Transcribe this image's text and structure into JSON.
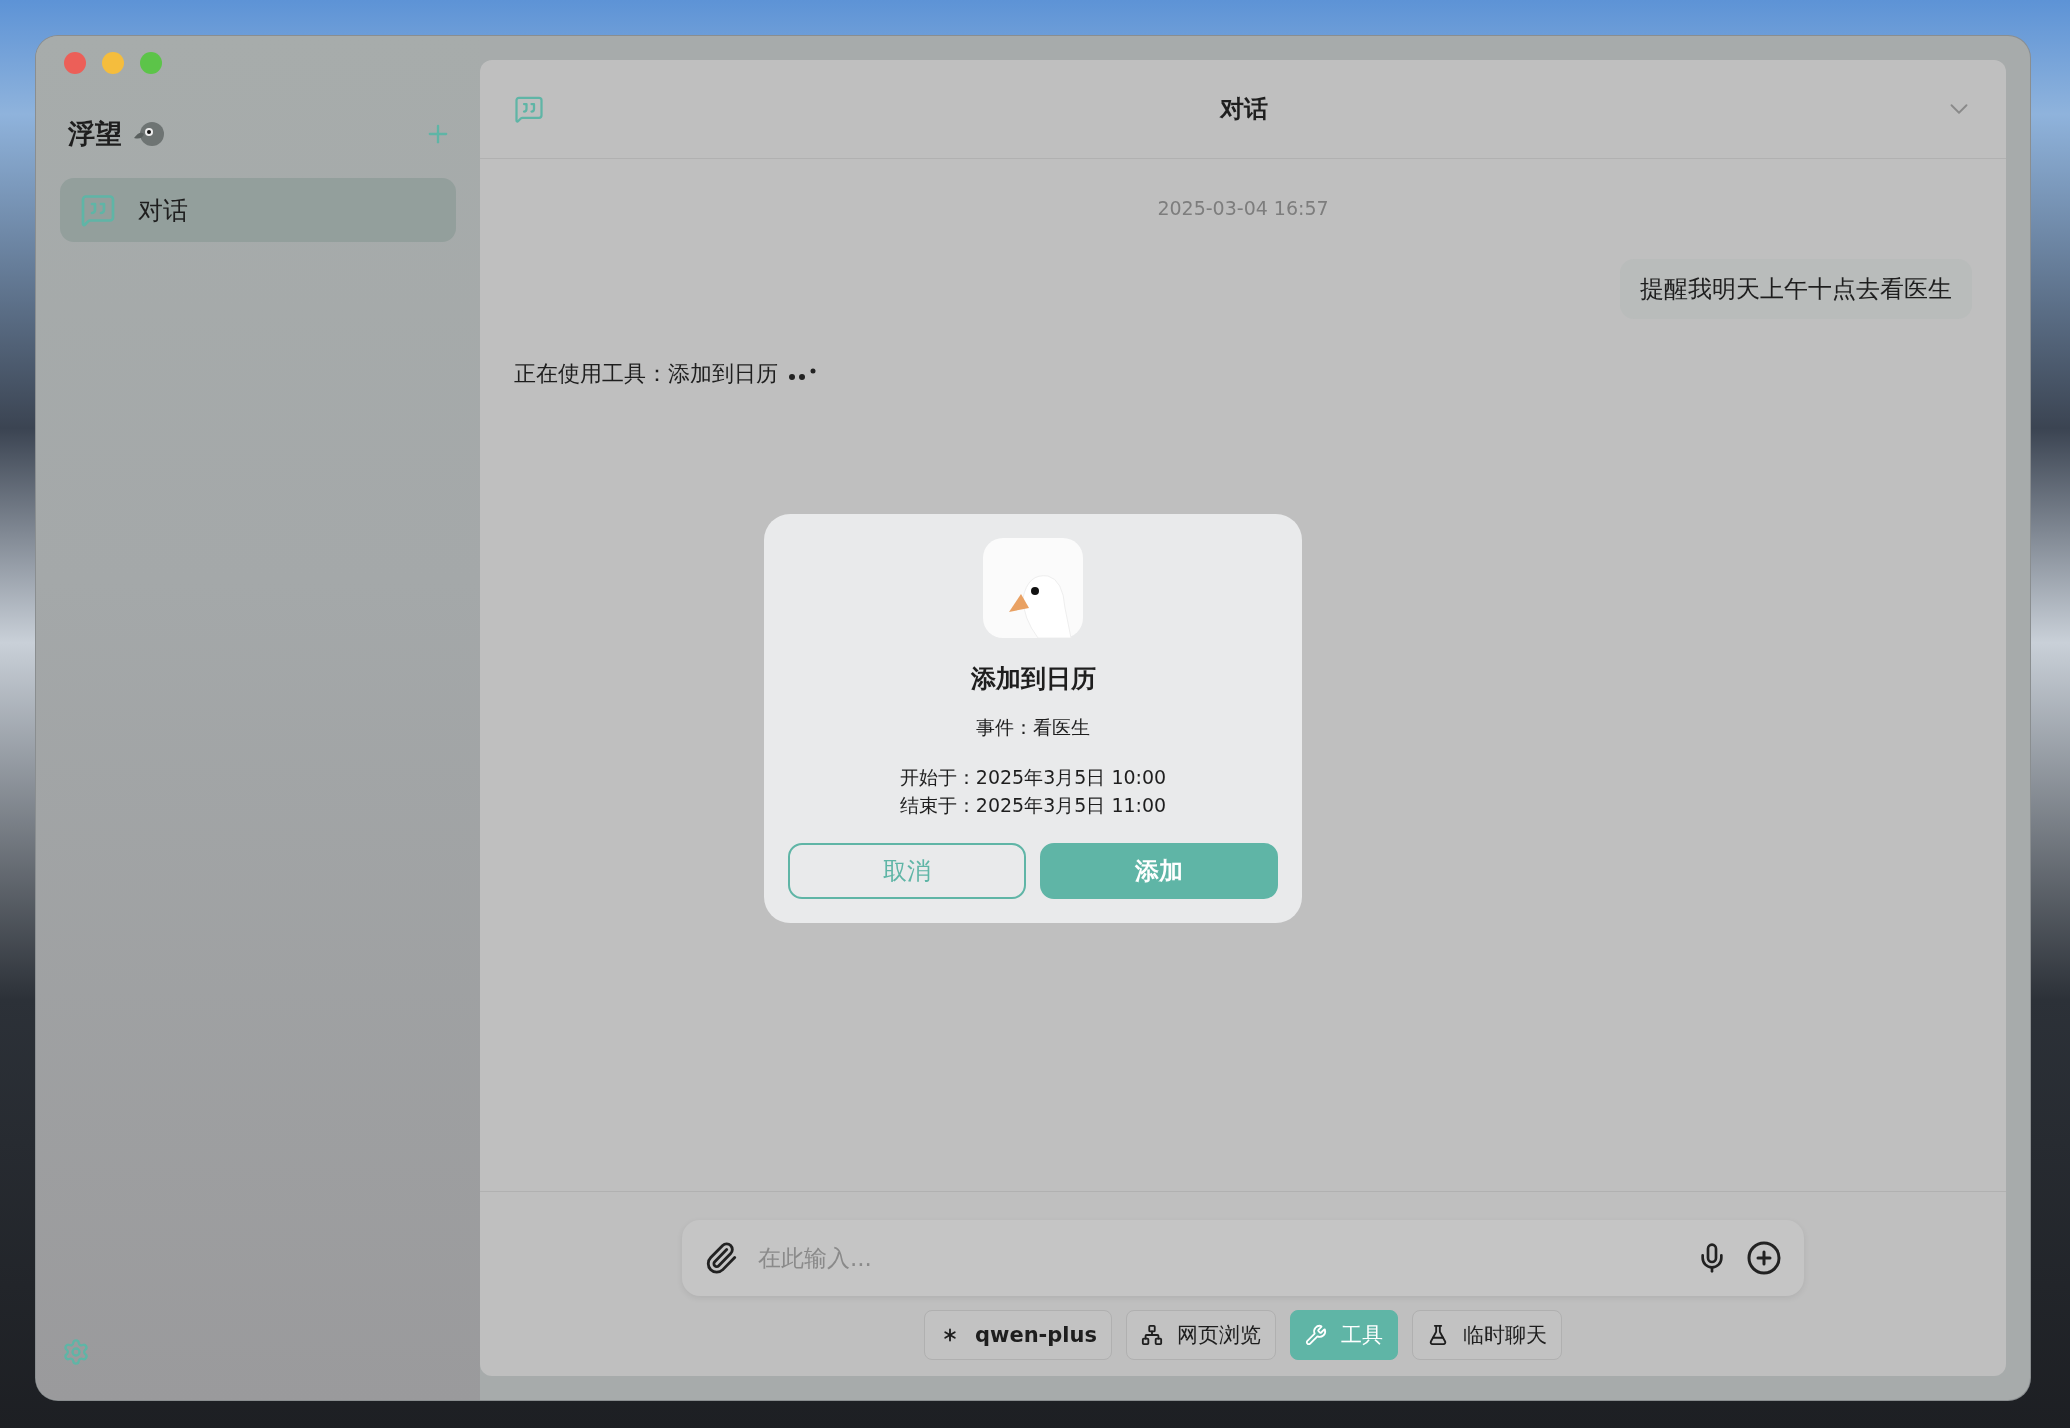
{
  "sidebar": {
    "app_name": "浮望",
    "items": [
      {
        "label": "对话",
        "selected": true
      }
    ]
  },
  "header": {
    "title": "对话"
  },
  "messages": [
    {
      "kind": "timestamp",
      "text": "2025-03-04 16:57"
    },
    {
      "kind": "user",
      "text": "提醒我明天上午十点去看医生"
    },
    {
      "kind": "status",
      "text": "正在使用工具：添加到日历"
    }
  ],
  "dialog": {
    "title": "添加到日历",
    "event": "事件：看医生",
    "start": "开始于：2025年3月5日 10:00",
    "end": "结束于：2025年3月5日 11:00",
    "buttons": [
      {
        "label": "取消",
        "kind": "secondary"
      },
      {
        "label": "添加",
        "kind": "primary"
      }
    ]
  },
  "composer": {
    "placeholder": "在此输入..."
  },
  "chips": [
    {
      "label": "qwen-plus",
      "kind": "model",
      "selected": false
    },
    {
      "label": "网页浏览",
      "kind": "web",
      "selected": false
    },
    {
      "label": "工具",
      "kind": "tools",
      "selected": true
    },
    {
      "label": "临时聊天",
      "kind": "temp",
      "selected": false
    }
  ]
}
